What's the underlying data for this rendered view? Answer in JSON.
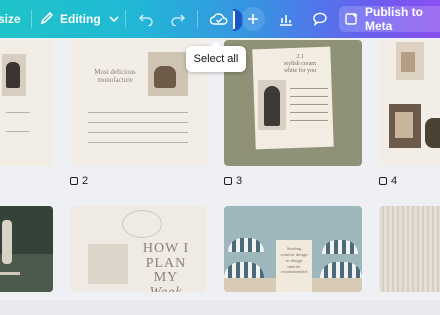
{
  "toolbar": {
    "resize_label": "size",
    "editing_label": "Editing",
    "publish_label": "Publish to Meta"
  },
  "tooltip": {
    "text": "Select all"
  },
  "pages": [
    {
      "num": ""
    },
    {
      "num": "2",
      "title": "Most delicious\nmonofacture"
    },
    {
      "num": "3",
      "title": "2.1\nstylish cream\nwhite for you"
    },
    {
      "num": "4"
    }
  ],
  "row2": {
    "card2_text": "HOW I\nPLAN MY\nWeek",
    "card3_text": "Starting\ncomfort design\nto design\ninterior\nrecommended"
  },
  "colors": {
    "accent": "#8a4ff0",
    "teal": "#1fc3c8"
  }
}
